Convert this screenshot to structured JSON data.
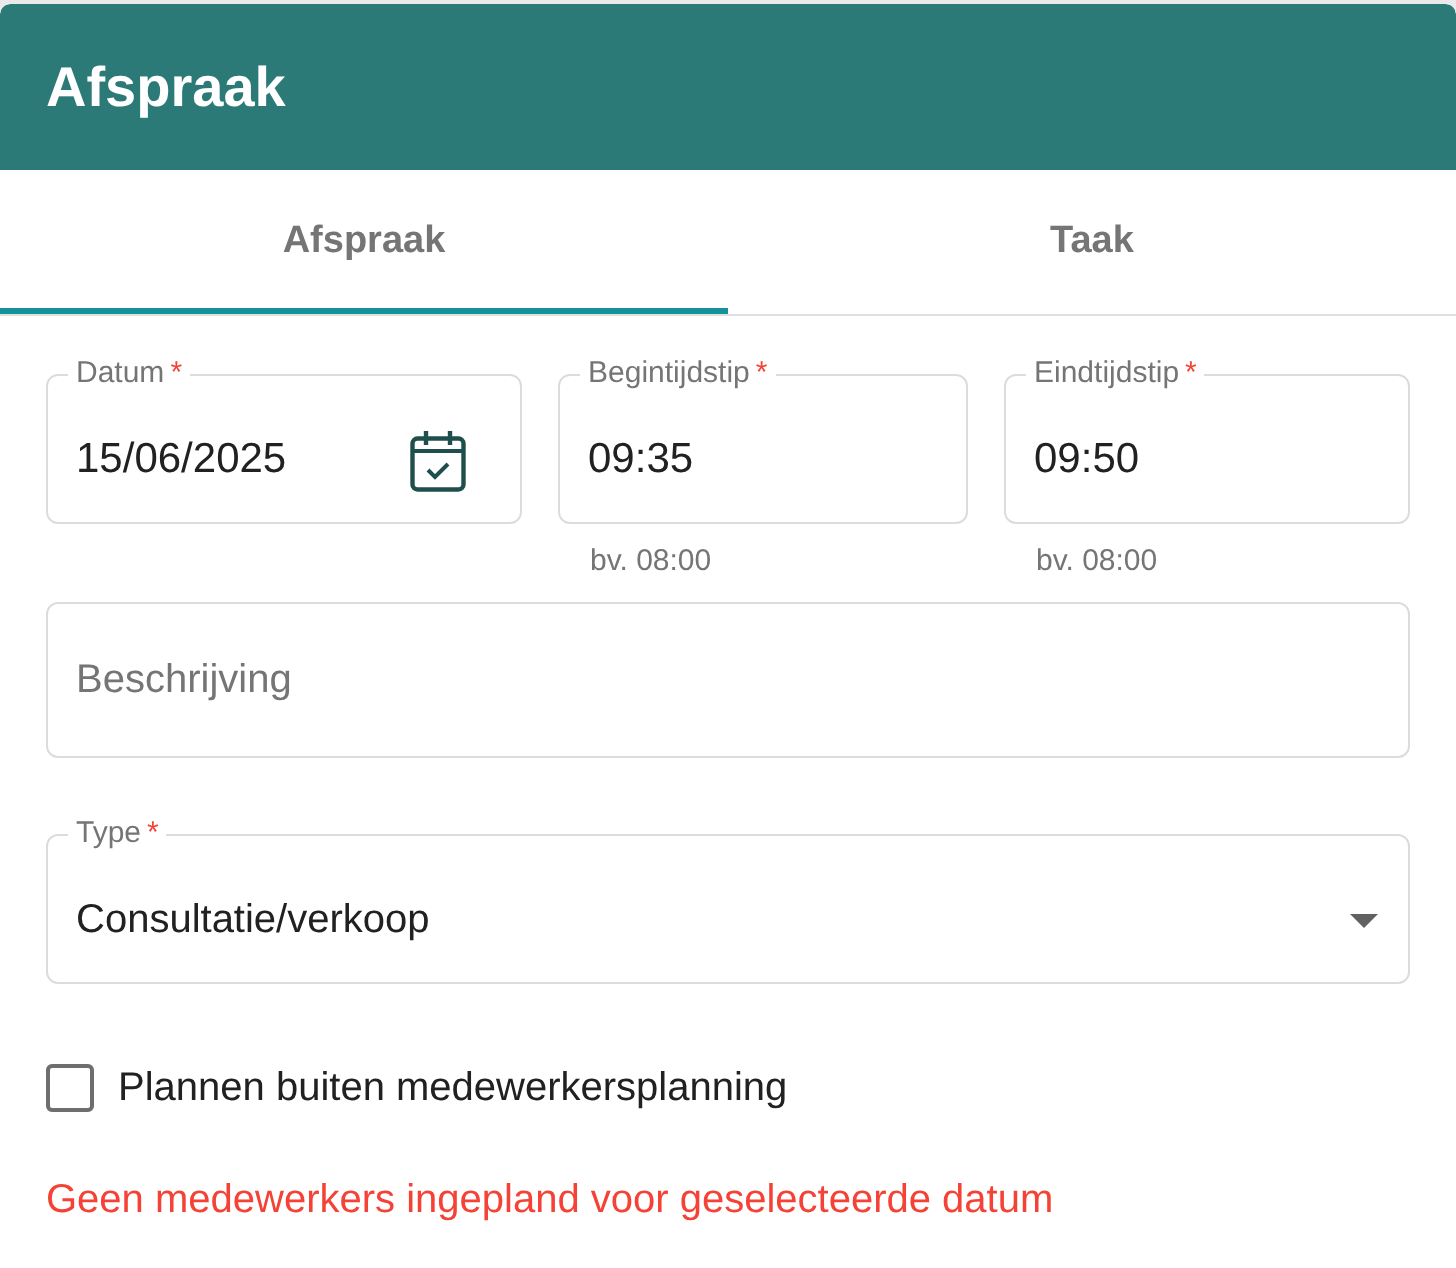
{
  "dialog": {
    "title": "Afspraak"
  },
  "tabs": [
    {
      "label": "Afspraak",
      "selected": true
    },
    {
      "label": "Taak",
      "selected": false
    }
  ],
  "fields": [
    {
      "kind": "date",
      "label": "Datum",
      "required_mark": "*",
      "value": "15/06/2025"
    },
    {
      "kind": "time",
      "label": "Begintijdstip",
      "required_mark": "*",
      "value": "09:35",
      "helper": "bv. 08:00"
    },
    {
      "kind": "time",
      "label": "Eindtijdstip",
      "required_mark": "*",
      "value": "09:50",
      "helper": "bv. 08:00"
    }
  ],
  "description": {
    "placeholder": "Beschrijving"
  },
  "type_select": {
    "label": "Type",
    "required_mark": "*",
    "value": "Consultatie/verkoop"
  },
  "schedule_outside": {
    "label": "Plannen buiten medewerkersplanning",
    "checked": false
  },
  "error": "Geen medewerkers ingepland voor geselecteerde datum"
}
